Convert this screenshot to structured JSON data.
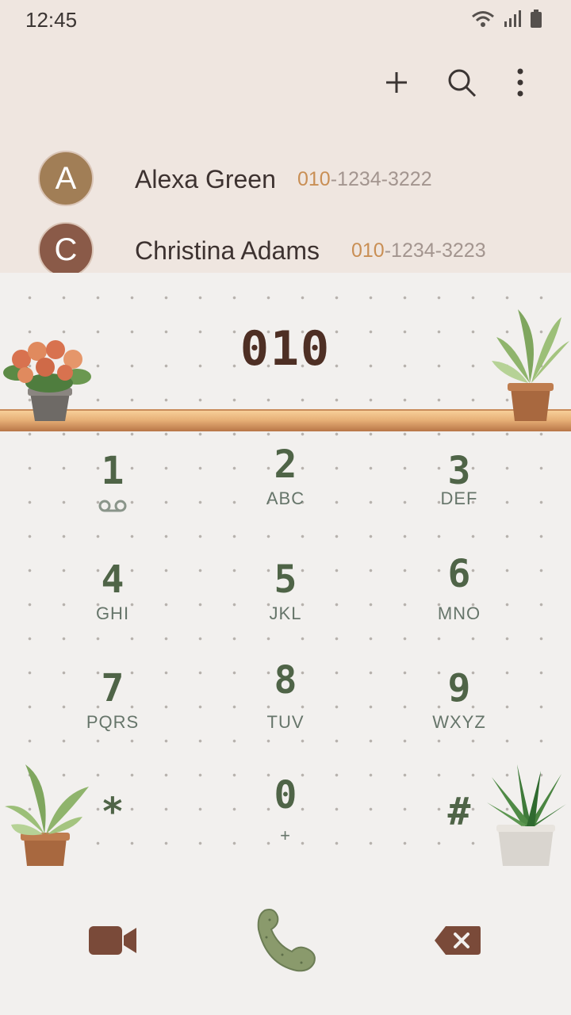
{
  "status_bar": {
    "time": "12:45"
  },
  "app_bar": {
    "icons": [
      "add-icon",
      "search-icon",
      "more-options-icon"
    ]
  },
  "contacts": [
    {
      "initial": "A",
      "name": "Alexa Green",
      "number_prefix": "010",
      "number_rest": "-1234-3222",
      "avatar_color": "#a17e56"
    },
    {
      "initial": "C",
      "name": "Christina Adams",
      "number_prefix": "010",
      "number_rest": "-1234-3223",
      "avatar_color": "#8a5a48"
    }
  ],
  "dialer": {
    "entry": "010"
  },
  "keypad": [
    {
      "digit": "1",
      "letters": ""
    },
    {
      "digit": "2",
      "letters": "ABC"
    },
    {
      "digit": "3",
      "letters": "DEF"
    },
    {
      "digit": "4",
      "letters": "GHI"
    },
    {
      "digit": "5",
      "letters": "JKL"
    },
    {
      "digit": "6",
      "letters": "MNO"
    },
    {
      "digit": "7",
      "letters": "PQRS"
    },
    {
      "digit": "8",
      "letters": "TUV"
    },
    {
      "digit": "9",
      "letters": "WXYZ"
    },
    {
      "digit": "*",
      "letters": ""
    },
    {
      "digit": "0",
      "letters": "+"
    },
    {
      "digit": "#",
      "letters": ""
    }
  ],
  "colors": {
    "accent_brown": "#4e2f24",
    "key_green": "#4f6447",
    "number_prefix": "#c98f55",
    "call_green": "#8a9a6c"
  }
}
